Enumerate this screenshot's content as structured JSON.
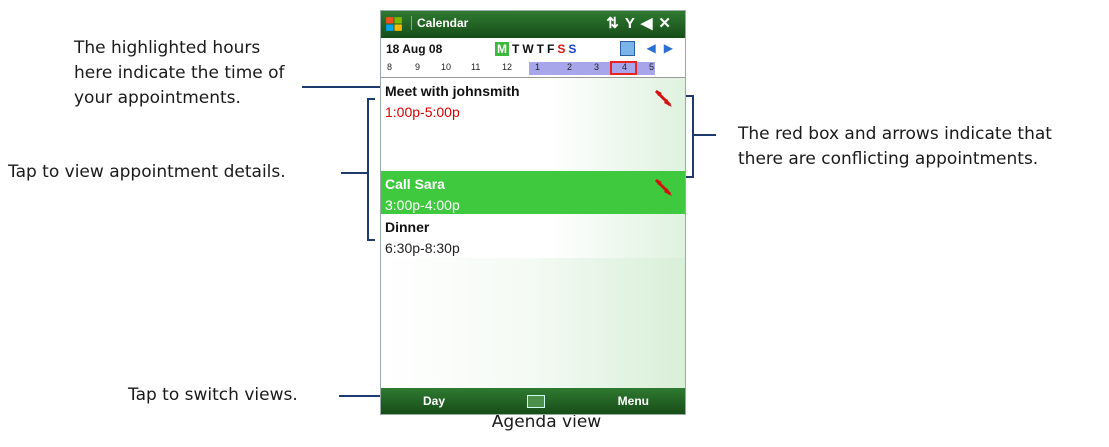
{
  "titlebar": {
    "app_title": "Calendar",
    "status_icons": "⇅ Y ◀ ✕"
  },
  "datebar": {
    "date": "18 Aug 08",
    "weekdays": {
      "selected": "M",
      "rest": "TWTF",
      "sat": "S",
      "sun": "S"
    }
  },
  "hours": [
    "8",
    "9",
    "10",
    "11",
    "12",
    "1",
    "2",
    "3",
    "4",
    "5"
  ],
  "appointments": [
    {
      "title": "Meet with johnsmith",
      "time": "1:00p-5:00p",
      "conflict": true
    },
    {
      "title": "Call Sara",
      "time": "3:00p-4:00p",
      "conflict": true
    },
    {
      "title": "Dinner",
      "time": "6:30p-8:30p",
      "conflict": false
    }
  ],
  "softkeys": {
    "left": "Day",
    "right": "Menu"
  },
  "annotations": {
    "hours_note": [
      "The highlighted hours",
      "here indicate the time of",
      "your appointments."
    ],
    "details_note": "Tap to view appointment details.",
    "conflict_note": [
      "The red box and arrows indicate that",
      "there are conflicting appointments."
    ],
    "switch_note": "Tap to switch views."
  },
  "caption": "Agenda view",
  "colors": {
    "titlebar": "#2f7a31",
    "selected_appt": "#3fc93f",
    "hour_highlight": "#a7a6ea",
    "conflict_red": "#e22222",
    "callout": "#1f3a6e"
  },
  "icons": [
    "windows-start-icon",
    "connectivity-icon",
    "signal-icon",
    "volume-icon",
    "close-icon",
    "today-icon",
    "prev-arrow-icon",
    "next-arrow-icon",
    "conflict-arrows-icon",
    "keyboard-icon"
  ]
}
